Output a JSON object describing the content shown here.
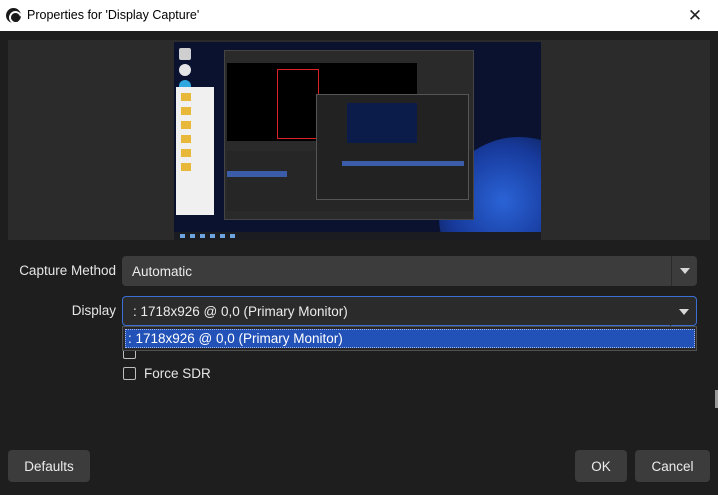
{
  "window": {
    "title": "Properties for 'Display Capture'",
    "close_glyph": "✕",
    "app_icon": "obs-logo-icon"
  },
  "preview": {
    "description_icon": "display-capture-preview"
  },
  "form": {
    "capture_method": {
      "label": "Capture Method",
      "value": "Automatic"
    },
    "display": {
      "label": "Display",
      "value": ": 1718x926 @ 0,0 (Primary Monitor)",
      "options": [
        ": 1718x926 @ 0,0 (Primary Monitor)"
      ]
    },
    "force_sdr": {
      "label": "Force SDR",
      "checked": false
    }
  },
  "buttons": {
    "defaults": "Defaults",
    "ok": "OK",
    "cancel": "Cancel"
  },
  "colors": {
    "background": "#1f1e1f",
    "field": "#3c3c3c",
    "selection": "#2252b8",
    "focus": "#3b6fd4"
  }
}
